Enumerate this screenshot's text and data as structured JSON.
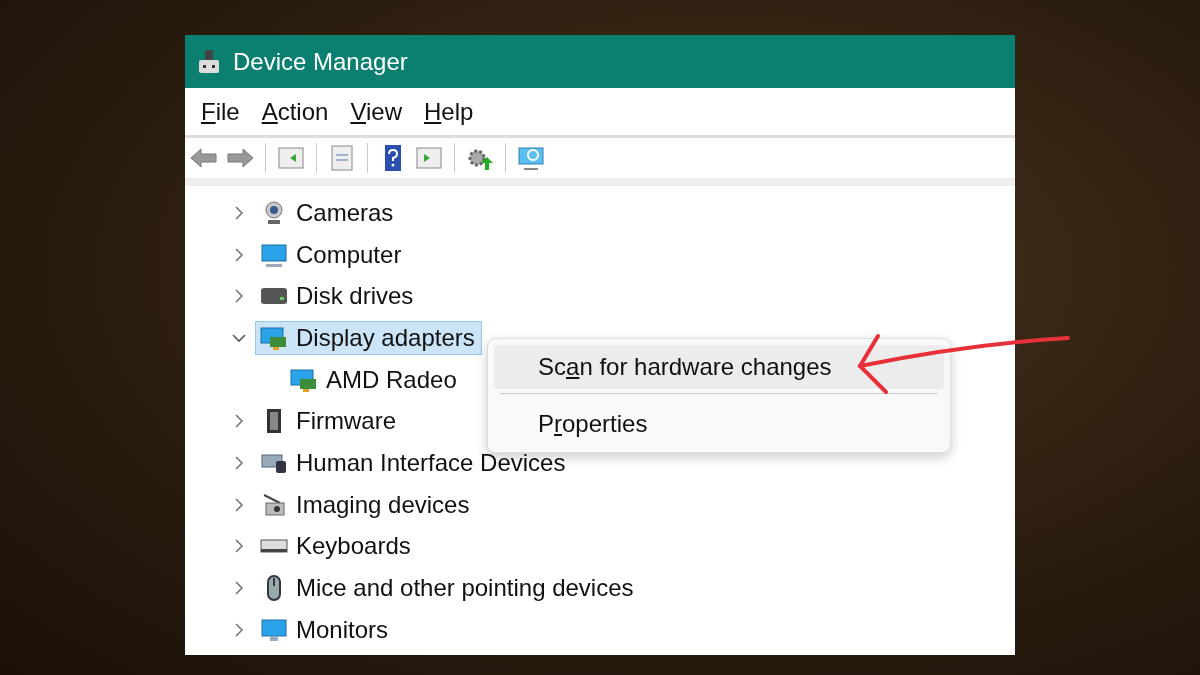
{
  "window": {
    "title": "Device Manager"
  },
  "menu_bar": [
    {
      "label": [
        {
          "text": "F",
          "underlined": true
        },
        {
          "text": "ile",
          "underlined": false
        }
      ]
    },
    {
      "label": [
        {
          "text": "A",
          "underlined": true
        },
        {
          "text": "ction",
          "underlined": false
        }
      ]
    },
    {
      "label": [
        {
          "text": "V",
          "underlined": true
        },
        {
          "text": "iew",
          "underlined": false
        }
      ]
    },
    {
      "label": [
        {
          "text": "H",
          "underlined": true
        },
        {
          "text": "elp",
          "underlined": false
        }
      ]
    }
  ],
  "tree": [
    {
      "label": "Cameras",
      "expanded": false,
      "selected": false
    },
    {
      "label": "Computer",
      "expanded": false,
      "selected": false
    },
    {
      "label": "Disk drives",
      "expanded": false,
      "selected": false
    },
    {
      "label": "Display adapters",
      "expanded": true,
      "selected": true,
      "children": [
        {
          "label": "AMD Radeo",
          "selected": false
        }
      ]
    },
    {
      "label": "Firmware",
      "expanded": false,
      "selected": false
    },
    {
      "label": "Human Interface Devices",
      "expanded": false,
      "selected": false
    },
    {
      "label": "Imaging devices",
      "expanded": false,
      "selected": false
    },
    {
      "label": "Keyboards",
      "expanded": false,
      "selected": false
    },
    {
      "label": "Mice and other pointing devices",
      "expanded": false,
      "selected": false
    },
    {
      "label": "Monitors",
      "expanded": false,
      "selected": false
    }
  ],
  "context_menu": [
    {
      "label": [
        {
          "text": "Sc",
          "underlined": false
        },
        {
          "text": "a",
          "underlined": true
        },
        {
          "text": "n for hardware changes",
          "underlined": false
        }
      ],
      "selected": true
    },
    {
      "label": [
        {
          "text": "P",
          "underlined": false
        },
        {
          "text": "r",
          "underlined": true
        },
        {
          "text": "operties",
          "underlined": false
        }
      ],
      "selected": false
    }
  ]
}
